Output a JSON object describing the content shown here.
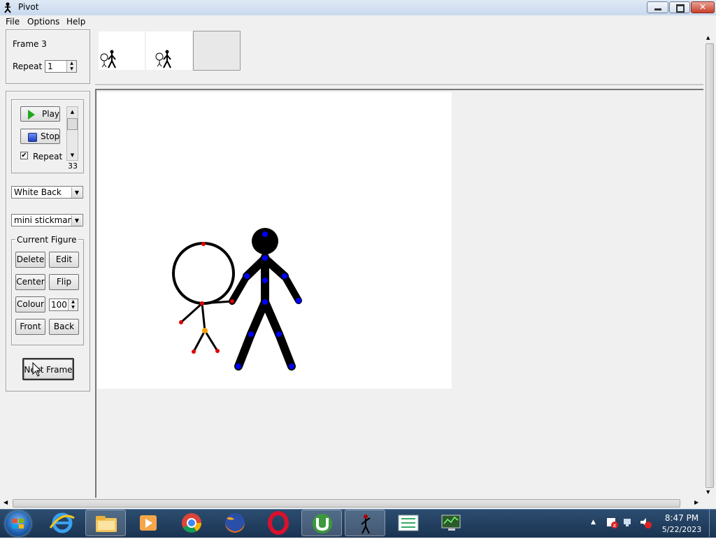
{
  "window": {
    "title": "Pivot",
    "app_icon": "stickman-icon"
  },
  "menu": [
    "File",
    "Options",
    "Help"
  ],
  "frame_panel": {
    "frame_label": "Frame 3",
    "repeat_label": "Repeat :",
    "repeat_value": "1"
  },
  "playback": {
    "play_label": "Play",
    "stop_label": "Stop",
    "repeat_checkbox_label": "Repeat",
    "repeat_checked": true,
    "speed_value": "33"
  },
  "background_select": "White Back",
  "figure_select": "mini stickman",
  "current_figure": {
    "title": "Current Figure",
    "delete_label": "Delete",
    "edit_label": "Edit",
    "center_label": "Center",
    "flip_label": "Flip",
    "colour_label": "Colour",
    "colour_value": "100",
    "front_label": "Front",
    "back_label": "Back"
  },
  "next_frame_label": "Next Frame",
  "frames": [
    {
      "label": "frame-1"
    },
    {
      "label": "frame-2"
    },
    {
      "label": "frame-3-empty"
    }
  ],
  "taskbar": {
    "apps": [
      "internet-explorer-icon",
      "file-explorer-icon",
      "media-player-icon",
      "chrome-icon",
      "firefox-icon",
      "opera-icon",
      "utorrent-icon",
      "pivot-icon",
      "task-list-icon",
      "network-monitor-icon"
    ],
    "time": "8:47 PM",
    "date": "5/22/2023"
  },
  "colors": {
    "joint_blue": "#0000ff",
    "joint_red": "#e00000",
    "joint_orange": "#f5a000",
    "stick": "#000000"
  }
}
